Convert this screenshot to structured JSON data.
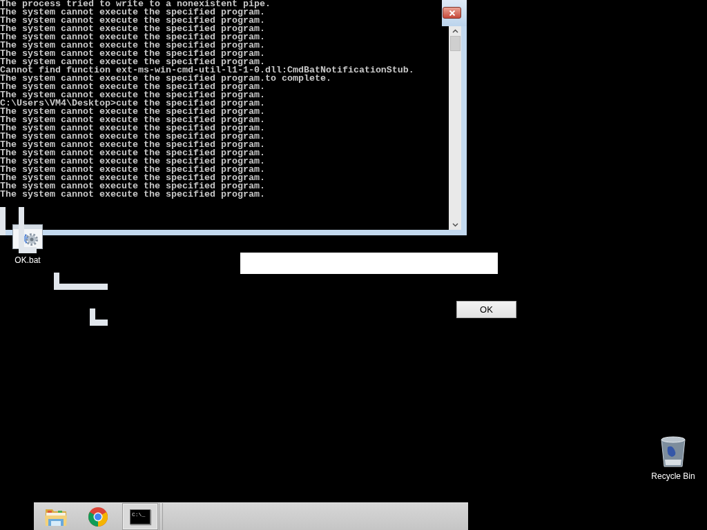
{
  "console": {
    "lines": [
      "The process tried to write to a nonexistent pipe.",
      "The system cannot execute the specified program.",
      "The system cannot execute the specified program.",
      "The system cannot execute the specified program.",
      "The system cannot execute the specified program.",
      "The system cannot execute the specified program.",
      "The system cannot execute the specified program.",
      "The system cannot execute the specified program.",
      "Cannot find function ext-ms-win-cmd-util-l1-1-0.dll:CmdBatNotificationStub.",
      "The system cannot execute the specified program.to complete.",
      "The system cannot execute the specified program.",
      "The system cannot execute the specified program.",
      "C:\\Users\\VM4\\Desktop>cute the specified program.",
      "The system cannot execute the specified program.",
      "The system cannot execute the specified program.",
      "The system cannot execute the specified program.",
      "The system cannot execute the specified program.",
      "The system cannot execute the specified program.",
      "The system cannot execute the specified program.",
      "The system cannot execute the specified program.",
      "The system cannot execute the specified program.",
      "The system cannot execute the specified program.",
      "The system cannot execute the specified program.",
      "The system cannot execute the specified program."
    ]
  },
  "desktop_icons": [
    {
      "kind": "batch",
      "label": "OK.bat"
    },
    {
      "kind": "recycle",
      "label": "Recycle Bin"
    }
  ],
  "dialog": {
    "button": "OK"
  },
  "taskbar": {
    "items": [
      {
        "kind": "folder",
        "selected": false
      },
      {
        "kind": "browser",
        "selected": false
      },
      {
        "kind": "console",
        "selected": true,
        "icon_text": "C:\\_"
      }
    ]
  }
}
